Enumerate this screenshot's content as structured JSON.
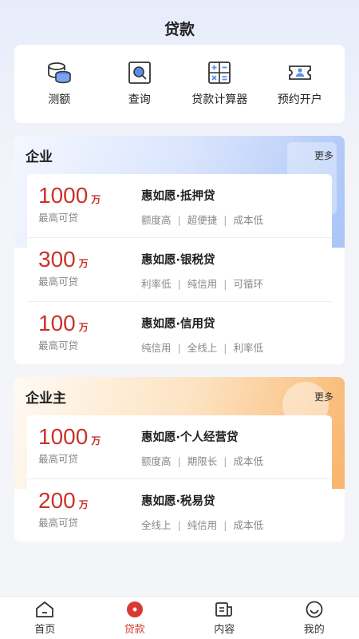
{
  "header": {
    "title": "贷款"
  },
  "quick_actions": [
    {
      "label": "测额",
      "icon": "coins-stack-icon"
    },
    {
      "label": "查询",
      "icon": "search-icon"
    },
    {
      "label": "贷款计算器",
      "icon": "calculator-icon"
    },
    {
      "label": "预约开户",
      "icon": "ticket-icon"
    }
  ],
  "sections": {
    "business": {
      "title": "企业",
      "more": "更多",
      "products": [
        {
          "amount": "1000",
          "unit": "万",
          "caption": "最高可贷",
          "name": "惠如愿·抵押贷",
          "tags": [
            "额度高",
            "超便捷",
            "成本低"
          ]
        },
        {
          "amount": "300",
          "unit": "万",
          "caption": "最高可贷",
          "name": "惠如愿·银税贷",
          "tags": [
            "利率低",
            "纯信用",
            "可循环"
          ]
        },
        {
          "amount": "100",
          "unit": "万",
          "caption": "最高可贷",
          "name": "惠如愿·信用贷",
          "tags": [
            "纯信用",
            "全线上",
            "利率低"
          ]
        }
      ]
    },
    "owner": {
      "title": "企业主",
      "more": "更多",
      "products": [
        {
          "amount": "1000",
          "unit": "万",
          "caption": "最高可贷",
          "name": "惠如愿·个人经营贷",
          "tags": [
            "额度高",
            "期限长",
            "成本低"
          ]
        },
        {
          "amount": "200",
          "unit": "万",
          "caption": "最高可贷",
          "name": "惠如愿·税易贷",
          "tags": [
            "全线上",
            "纯信用",
            "成本低"
          ]
        }
      ]
    }
  },
  "tabbar": [
    {
      "label": "首页",
      "icon": "home-icon",
      "active": false
    },
    {
      "label": "贷款",
      "icon": "loan-icon",
      "active": true
    },
    {
      "label": "内容",
      "icon": "content-icon",
      "active": false
    },
    {
      "label": "我的",
      "icon": "profile-icon",
      "active": false
    }
  ],
  "colors": {
    "accent": "#c8342a",
    "business_gradient": "#a9c4f6",
    "owner_gradient": "#f8b46a"
  }
}
